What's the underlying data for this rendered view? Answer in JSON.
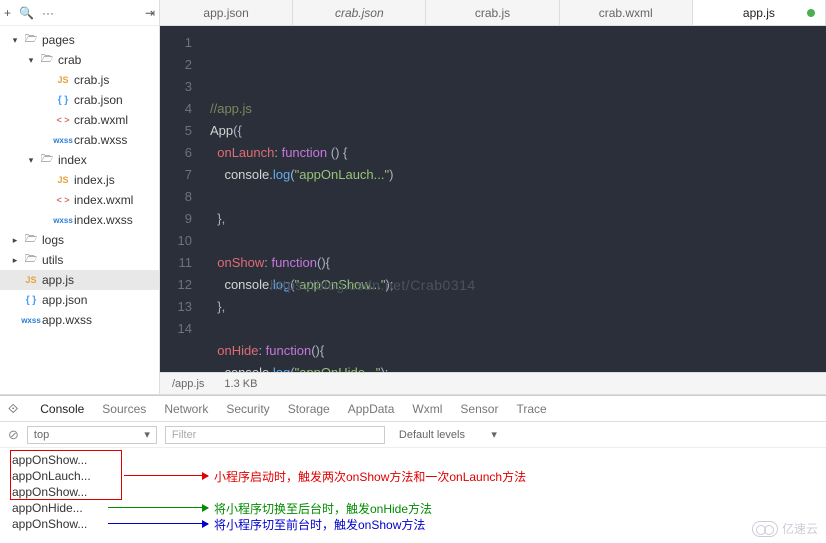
{
  "sidebar": {
    "toolbar_icons": [
      "+",
      "🔍",
      "···",
      "⇥"
    ],
    "tree": [
      {
        "depth": 0,
        "caret": "▾",
        "icon": "folder",
        "label": "pages"
      },
      {
        "depth": 1,
        "caret": "▾",
        "icon": "folder",
        "label": "crab"
      },
      {
        "depth": 2,
        "caret": "",
        "icon": "js",
        "label": "crab.js"
      },
      {
        "depth": 2,
        "caret": "",
        "icon": "json",
        "label": "crab.json"
      },
      {
        "depth": 2,
        "caret": "",
        "icon": "wxml",
        "label": "crab.wxml"
      },
      {
        "depth": 2,
        "caret": "",
        "icon": "wxss",
        "label": "crab.wxss"
      },
      {
        "depth": 1,
        "caret": "▾",
        "icon": "folder",
        "label": "index"
      },
      {
        "depth": 2,
        "caret": "",
        "icon": "js",
        "label": "index.js"
      },
      {
        "depth": 2,
        "caret": "",
        "icon": "wxml",
        "label": "index.wxml"
      },
      {
        "depth": 2,
        "caret": "",
        "icon": "wxss",
        "label": "index.wxss"
      },
      {
        "depth": 0,
        "caret": "▸",
        "icon": "folder",
        "label": "logs"
      },
      {
        "depth": 0,
        "caret": "▸",
        "icon": "folder",
        "label": "utils"
      },
      {
        "depth": 0,
        "caret": "",
        "icon": "js",
        "label": "app.js",
        "active": true
      },
      {
        "depth": 0,
        "caret": "",
        "icon": "json",
        "label": "app.json"
      },
      {
        "depth": 0,
        "caret": "",
        "icon": "wxss",
        "label": "app.wxss"
      }
    ],
    "icon_text": {
      "folder": "🗁",
      "js": "JS",
      "json": "{ }",
      "wxml": "< >",
      "wxss": "wxss"
    }
  },
  "tabs": [
    {
      "label": "app.json"
    },
    {
      "label": "crab.json",
      "italic": true
    },
    {
      "label": "crab.js"
    },
    {
      "label": "crab.wxml"
    },
    {
      "label": "app.js",
      "active": true,
      "modified": true
    }
  ],
  "code": {
    "lines": [
      [
        {
          "t": "comment",
          "v": "//app.js"
        }
      ],
      [
        {
          "t": "ident",
          "v": "App"
        },
        {
          "t": "punc",
          "v": "({"
        }
      ],
      [
        {
          "t": "indent",
          "v": "  "
        },
        {
          "t": "prop",
          "v": "onLaunch"
        },
        {
          "t": "punc",
          "v": ": "
        },
        {
          "t": "key",
          "v": "function"
        },
        {
          "t": "punc",
          "v": " () {"
        }
      ],
      [
        {
          "t": "indent",
          "v": "    "
        },
        {
          "t": "ident",
          "v": "console"
        },
        {
          "t": "punc",
          "v": "."
        },
        {
          "t": "fn",
          "v": "log"
        },
        {
          "t": "punc",
          "v": "("
        },
        {
          "t": "str",
          "v": "\"appOnLauch...\""
        },
        {
          "t": "punc",
          "v": ")"
        }
      ],
      [],
      [
        {
          "t": "indent",
          "v": "  "
        },
        {
          "t": "punc",
          "v": "},"
        }
      ],
      [],
      [
        {
          "t": "indent",
          "v": "  "
        },
        {
          "t": "prop",
          "v": "onShow"
        },
        {
          "t": "punc",
          "v": ": "
        },
        {
          "t": "key",
          "v": "function"
        },
        {
          "t": "punc",
          "v": "(){"
        }
      ],
      [
        {
          "t": "indent",
          "v": "    "
        },
        {
          "t": "ident",
          "v": "console"
        },
        {
          "t": "punc",
          "v": "."
        },
        {
          "t": "fn",
          "v": "log"
        },
        {
          "t": "punc",
          "v": "("
        },
        {
          "t": "str",
          "v": "\"appOnShow...\""
        },
        {
          "t": "punc",
          "v": ");"
        }
      ],
      [
        {
          "t": "indent",
          "v": "  "
        },
        {
          "t": "punc",
          "v": "},"
        }
      ],
      [],
      [
        {
          "t": "indent",
          "v": "  "
        },
        {
          "t": "prop",
          "v": "onHide"
        },
        {
          "t": "punc",
          "v": ": "
        },
        {
          "t": "key",
          "v": "function"
        },
        {
          "t": "punc",
          "v": "(){"
        }
      ],
      [
        {
          "t": "indent",
          "v": "    "
        },
        {
          "t": "ident",
          "v": "console"
        },
        {
          "t": "punc",
          "v": "."
        },
        {
          "t": "fn",
          "v": "log"
        },
        {
          "t": "punc",
          "v": "("
        },
        {
          "t": "str",
          "v": "\"appOnHide...\""
        },
        {
          "t": "punc",
          "v": ");"
        }
      ],
      [
        {
          "t": "indent",
          "v": "  "
        },
        {
          "t": "punc",
          "v": "},"
        }
      ]
    ],
    "watermark": "https://blog.csdn.net/Crab0314"
  },
  "status": {
    "path": "/app.js",
    "size": "1.3 KB"
  },
  "devtools": {
    "tabs": [
      "Console",
      "Sources",
      "Network",
      "Security",
      "Storage",
      "AppData",
      "Wxml",
      "Sensor",
      "Trace"
    ],
    "active_tab": "Console",
    "context": "top",
    "filter_placeholder": "Filter",
    "levels": "Default levels",
    "logs": [
      "appOnShow...",
      "appOnLauch...",
      "appOnShow...",
      "appOnHide...",
      "appOnShow..."
    ],
    "annotations": {
      "red": "小程序启动时，触发两次onShow方法和一次onLaunch方法",
      "green": "将小程序切换至后台时，触发onHide方法",
      "blue": "将小程序切至前台时，触发onShow方法"
    }
  },
  "brand": "亿速云"
}
